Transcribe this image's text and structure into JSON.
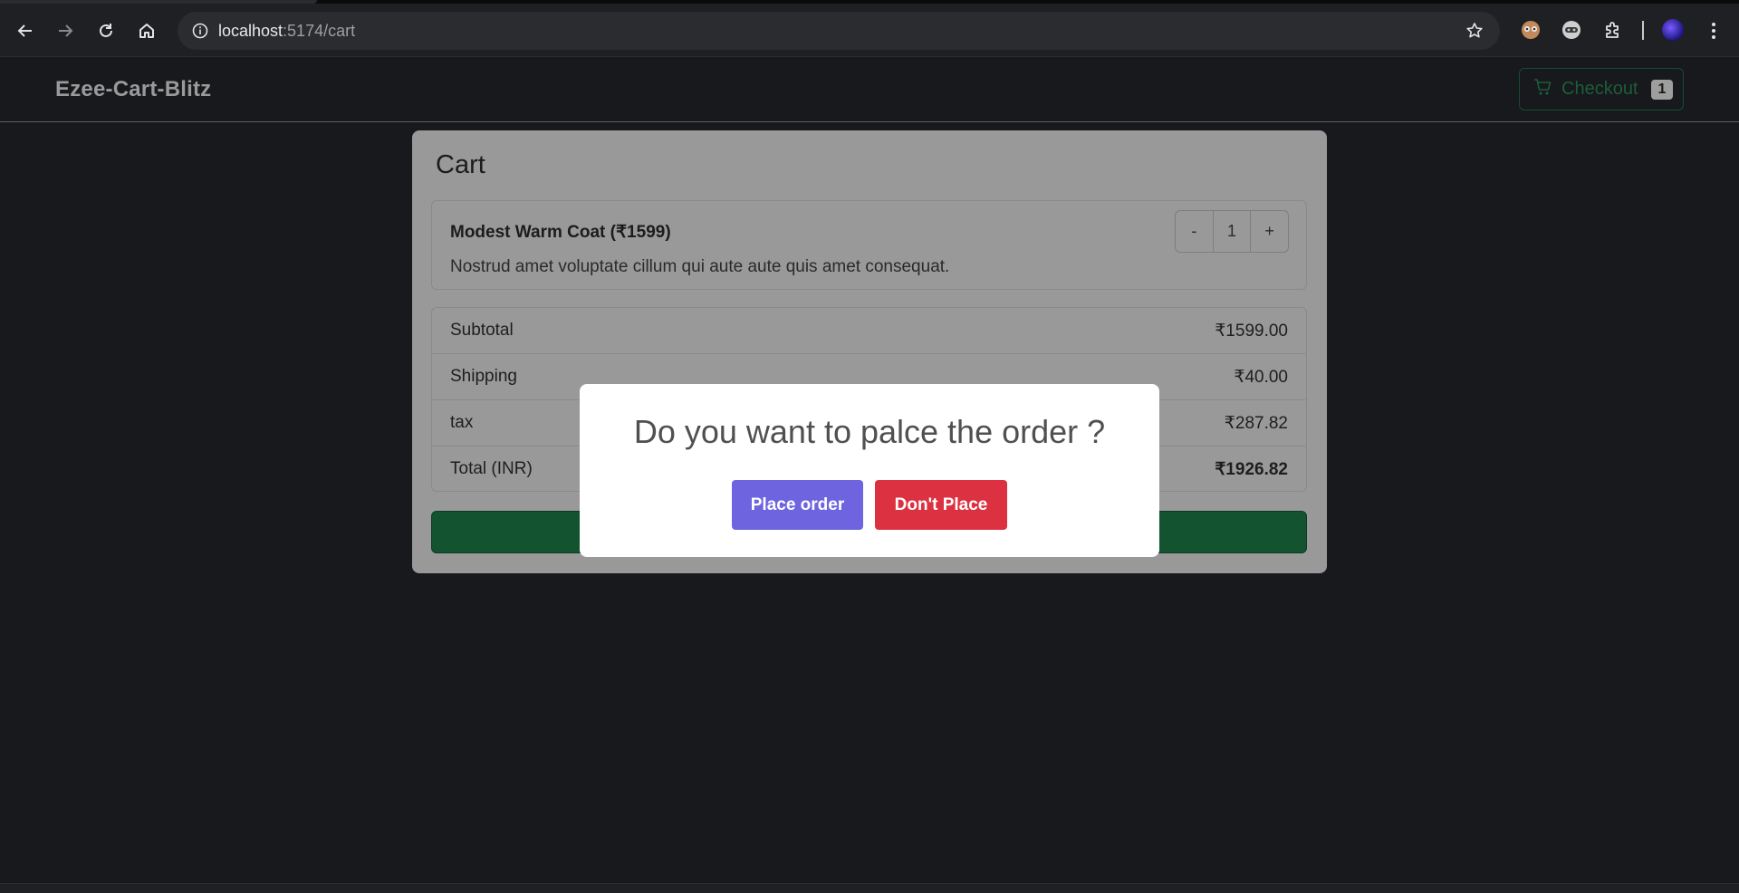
{
  "browser": {
    "url_host": "localhost",
    "url_path": ":5174/cart",
    "icons": [
      "back-arrow-icon",
      "forward-arrow-icon",
      "reload-icon",
      "home-icon",
      "site-info-icon",
      "bookmark-star-icon",
      "extension-icon",
      "puzzle-icon",
      "profile-avatar",
      "more-vert-icon"
    ]
  },
  "navbar": {
    "brand": "Ezee-Cart-Blitz",
    "checkout_label": "Checkout",
    "checkout_count": "1"
  },
  "cart": {
    "title": "Cart",
    "item": {
      "name": "Modest Warm Coat (₹1599)",
      "description": "Nostrud amet voluptate cillum qui aute aute quis amet consequat.",
      "minus": "-",
      "quantity": "1",
      "plus": "+"
    },
    "summary": [
      {
        "label": "Subtotal",
        "value": "₹1599.00"
      },
      {
        "label": "Shipping",
        "value": "₹40.00"
      },
      {
        "label": "tax",
        "value": "₹287.82"
      },
      {
        "label": "Total (INR)",
        "value": "₹1926.82"
      }
    ]
  },
  "modal": {
    "question": "Do you want to palce the order ?",
    "confirm": "Place order",
    "cancel": "Don't Place"
  },
  "colors": {
    "page_bg": "#17191d",
    "cart_overlay": "#999999",
    "place_button": "#6e64e0",
    "dont_place_button": "#dc3140",
    "checkout_green": "#1d5d3a"
  }
}
